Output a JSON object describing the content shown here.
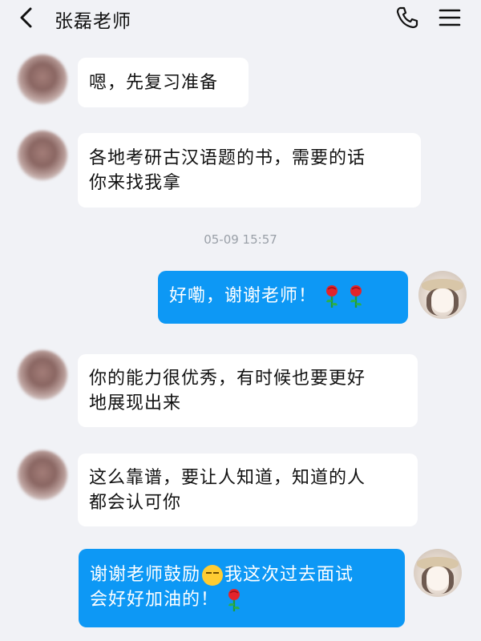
{
  "header": {
    "title": "张磊老师"
  },
  "icons": {
    "back": "back-arrow-icon",
    "phone": "phone-icon",
    "menu": "menu-icon"
  },
  "timestamp": "05-09 15:57",
  "messages": [
    {
      "side": "incoming",
      "lines": [
        "嗯，先复习准备"
      ]
    },
    {
      "side": "incoming",
      "lines": [
        "各地考研古汉语题的书，需要的话",
        "你来找我拿"
      ]
    },
    {
      "side": "outgoing",
      "lines": [
        "好嘞，谢谢老师！"
      ],
      "emoji_after": [
        "rose",
        "rose"
      ]
    },
    {
      "side": "incoming",
      "lines": [
        "你的能力很优秀，有时候也要更好",
        "地展现出来"
      ]
    },
    {
      "side": "incoming",
      "lines": [
        "这么靠谱，要让人知道，知道的人",
        "都会认可你"
      ]
    },
    {
      "side": "outgoing",
      "lines": [
        "谢谢老师鼓励",
        "我这次过去面试",
        "会好好加油的！"
      ],
      "emoji": [
        "pensive-face",
        "rose"
      ]
    }
  ],
  "colors": {
    "background": "#f1f2f6",
    "outgoing_bubble": "#0d98f5",
    "incoming_bubble": "#ffffff"
  }
}
